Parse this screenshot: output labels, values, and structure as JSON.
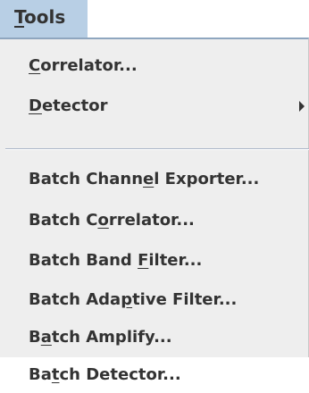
{
  "menubar": {
    "tools": {
      "pre": "",
      "mn": "T",
      "post": "ools"
    }
  },
  "menu": {
    "items": [
      {
        "pre": "",
        "mn": "C",
        "post": "orrelator..."
      },
      {
        "pre": "",
        "mn": "D",
        "post": "etector"
      },
      {
        "pre": "Batch Chann",
        "mn": "e",
        "post": "l Exporter..."
      },
      {
        "pre": "Batch C",
        "mn": "o",
        "post": "rrelator..."
      },
      {
        "pre": "Batch Band ",
        "mn": "F",
        "post": "ilter..."
      },
      {
        "pre": "Batch Ada",
        "mn": "p",
        "post": "tive Filter..."
      },
      {
        "pre": "B",
        "mn": "a",
        "post": "tch Amplify..."
      },
      {
        "pre": "Ba",
        "mn": "t",
        "post": "ch Detector..."
      }
    ]
  },
  "colors": {
    "menubar_selected": "#b8cfe5",
    "popup_background": "#eeeeee",
    "popup_border": "#8fa6bf",
    "text": "#333333"
  },
  "icons": {
    "submenu_arrow": "triangle-right"
  }
}
